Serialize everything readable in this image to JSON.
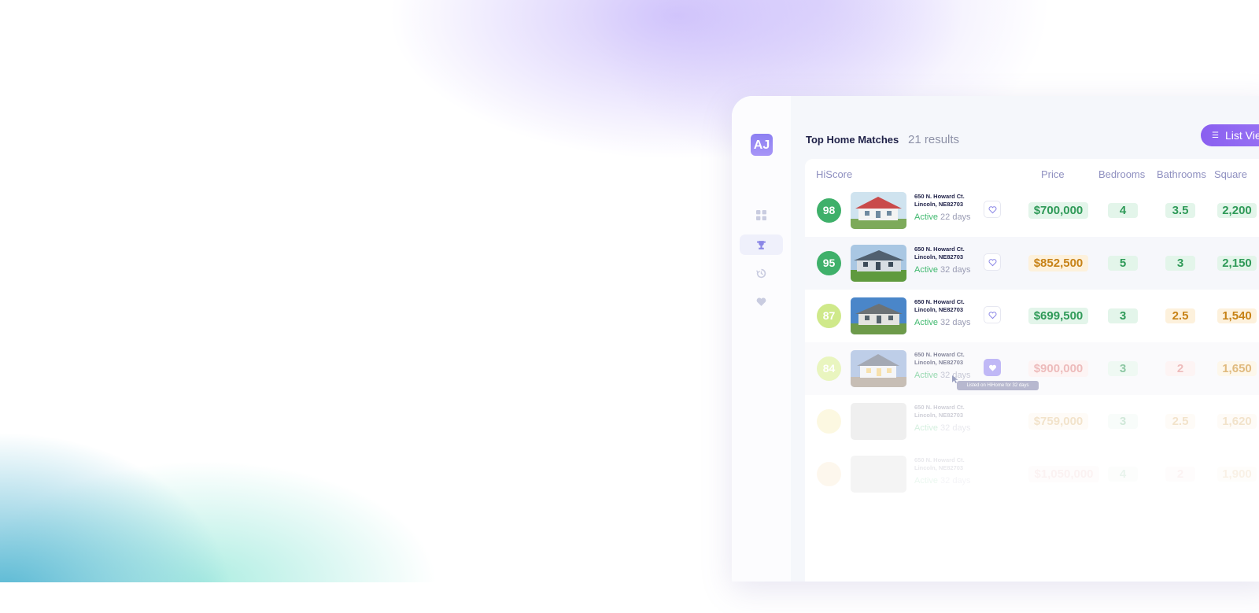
{
  "app": {
    "avatar_initials": "AJ"
  },
  "sidebar": {
    "items": [
      {
        "icon": "dashboard-grid-icon",
        "active": false
      },
      {
        "icon": "trophy-icon",
        "active": true
      },
      {
        "icon": "history-icon",
        "active": false
      },
      {
        "icon": "heart-icon",
        "active": false
      }
    ]
  },
  "header": {
    "title": "Top Home Matches",
    "result_count": "21 results",
    "list_view_label": "List View",
    "list_view_icon": "list-icon"
  },
  "table": {
    "columns": [
      "HiScore",
      "Price",
      "Bedrooms",
      "Bathrooms",
      "Square"
    ],
    "rows": [
      {
        "score": "98",
        "address_line1": "650 N. Howard Ct.",
        "address_line2": "Lincoln, NE82703",
        "status": "Active",
        "days": "22 days",
        "price": "$700,000",
        "bedrooms": "4",
        "bathrooms": "3.5",
        "square": "2,200",
        "favorited": false
      },
      {
        "score": "95",
        "address_line1": "650 N. Howard Ct.",
        "address_line2": "Lincoln, NE82703",
        "status": "Active",
        "days": "32 days",
        "price": "$852,500",
        "bedrooms": "5",
        "bathrooms": "3",
        "square": "2,150",
        "favorited": false
      },
      {
        "score": "87",
        "address_line1": "650 N. Howard Ct.",
        "address_line2": "Lincoln, NE82703",
        "status": "Active",
        "days": "32 days",
        "price": "$699,500",
        "bedrooms": "3",
        "bathrooms": "2.5",
        "square": "1,540",
        "favorited": false
      },
      {
        "score": "84",
        "address_line1": "650 N. Howard Ct.",
        "address_line2": "Lincoln, NE82703",
        "status": "Active",
        "days": "32 days",
        "price": "$900,000",
        "bedrooms": "3",
        "bathrooms": "2",
        "square": "1,650",
        "favorited": true
      },
      {
        "score": "",
        "address_line1": "650 N. Howard Ct.",
        "address_line2": "Lincoln, NE82703",
        "status": "Active",
        "days": "32 days",
        "price": "$759,000",
        "bedrooms": "3",
        "bathrooms": "2.5",
        "square": "1,620",
        "favorited": false
      },
      {
        "score": "",
        "address_line1": "650 N. Howard Ct.",
        "address_line2": "Lincoln, NE82703",
        "status": "Active",
        "days": "32 days",
        "price": "$1,050,000",
        "bedrooms": "4",
        "bathrooms": "2",
        "square": "1,900",
        "favorited": false
      }
    ]
  },
  "tooltip": {
    "text": "Listed on HiHome for 32 days"
  },
  "colors": {
    "accent": "#8a5ff0",
    "green": "#2f9a58",
    "orange": "#c78216",
    "red": "#e08585"
  }
}
